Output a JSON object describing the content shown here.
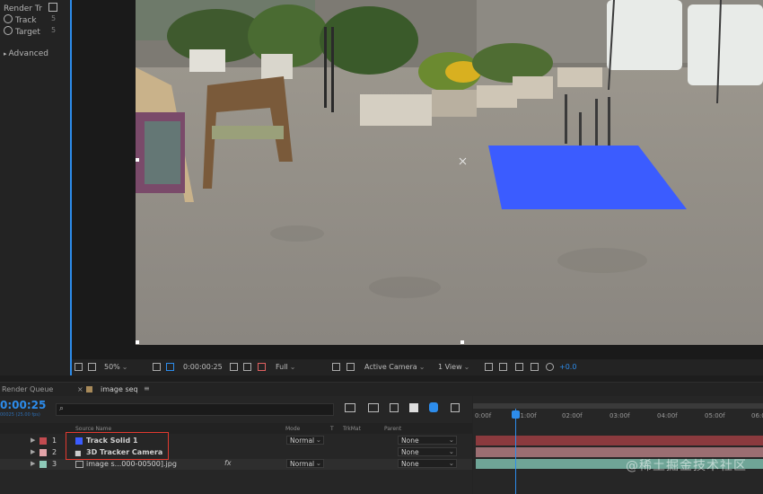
{
  "effect_panel": {
    "render_track_label": "Render Tr",
    "track_label": "Track",
    "target_label": "Target",
    "advanced_label": "Advanced",
    "val1": "5",
    "val2": "5"
  },
  "viewer_toolbar": {
    "zoom": "50%",
    "timecode": "0:00:00:25",
    "resolution": "Full",
    "camera": "Active Camera",
    "view": "1 View",
    "exposure": "+0.0"
  },
  "timeline": {
    "render_queue_tab": "Render Queue",
    "comp_tab": "image seq",
    "current_time": "0:00:25",
    "fps": "00025 (25.00 fps)",
    "search_placeholder": "",
    "columns": {
      "source_name": "Source Name",
      "mode": "Mode",
      "t": "T",
      "trkmat": "TrkMat",
      "parent": "Parent"
    },
    "ruler": [
      "0:00f",
      "01:00f",
      "02:00f",
      "03:00f",
      "04:00f",
      "05:00f",
      "06:0"
    ],
    "layers": [
      {
        "num": "1",
        "name": "Track Solid 1",
        "mode": "Normal",
        "parent": "None",
        "color": "#c24b50",
        "bar": "#8b3a3e"
      },
      {
        "num": "2",
        "name": "3D Tracker Camera",
        "mode": "",
        "parent": "None",
        "color": "#e3a3a8",
        "bar": "#9b6e72"
      },
      {
        "num": "3",
        "name": "image s...000-00500].jpg",
        "mode": "Normal",
        "parent": "None",
        "color": "#8ec9b8",
        "bar": "#6fa597"
      }
    ]
  },
  "watermark": "@稀土掘金技术社区",
  "colors": {
    "accent": "#2d8ceb",
    "track_solid": "#3b5cff"
  }
}
